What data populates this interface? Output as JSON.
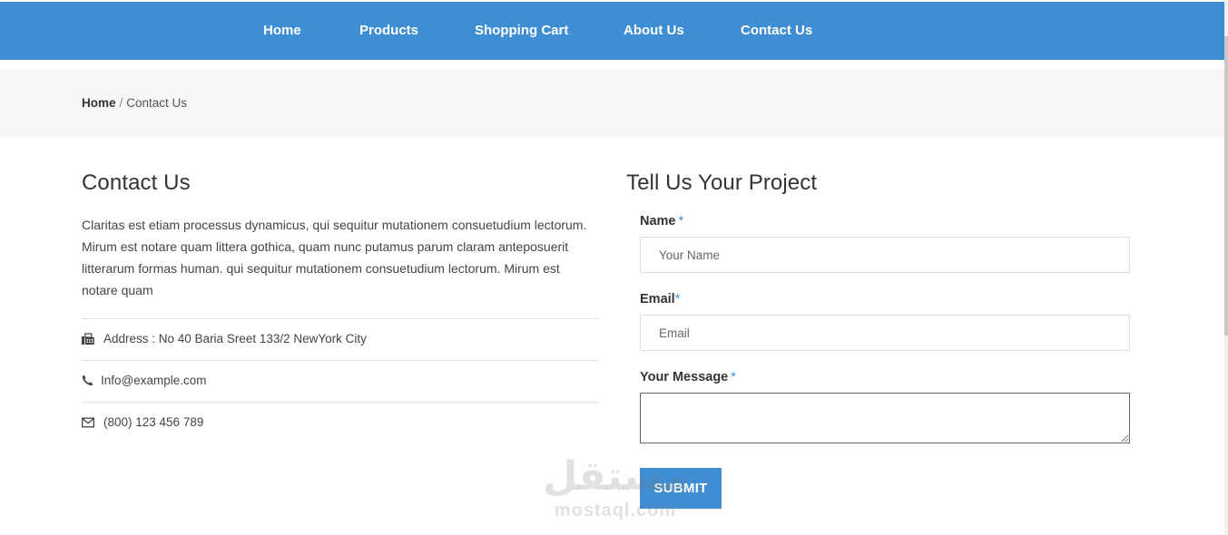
{
  "nav": {
    "items": [
      {
        "label": "Home"
      },
      {
        "label": "Products"
      },
      {
        "label": "Shopping Cart"
      },
      {
        "label": "About Us"
      },
      {
        "label": "Contact Us"
      }
    ]
  },
  "breadcrumb": {
    "home": "Home",
    "separator": "/",
    "current": "Contact Us"
  },
  "contact": {
    "title": "Contact Us",
    "description": "Claritas est etiam processus dynamicus, qui sequitur mutationem consuetudium lectorum. Mirum est notare quam littera gothica, quam nunc putamus parum claram anteposuerit litterarum formas human. qui sequitur mutationem consuetudium lectorum. Mirum est notare quam",
    "address": "Address : No 40 Baria Sreet 133/2 NewYork City",
    "email": "Info@example.com",
    "phone": "(800) 123 456 789",
    "icons": [
      "fax-icon",
      "phone-icon",
      "envelope-icon"
    ]
  },
  "form": {
    "title": "Tell Us Your Project",
    "name_label": "Name",
    "name_placeholder": "Your Name",
    "email_label": "Email",
    "email_placeholder": "Email",
    "message_label": "Your Message",
    "message_value": "",
    "required_mark": "*",
    "submit_label": "SUBMIT"
  },
  "watermark": {
    "text_arabic": "مستقل",
    "text_latin": "mostaql.com"
  },
  "colors": {
    "accent": "#3f8ed4",
    "breadcrumb_bg": "#f6f6f6",
    "text": "#333333"
  }
}
